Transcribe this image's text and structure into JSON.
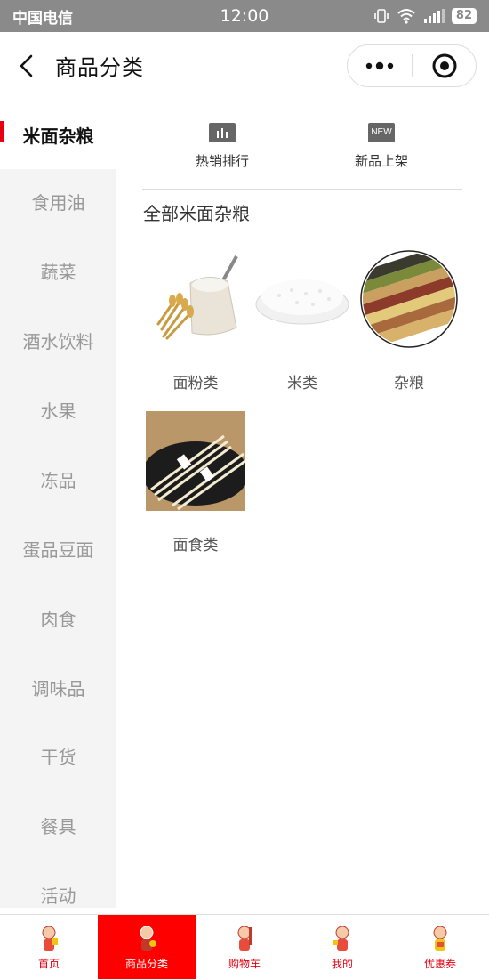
{
  "status_bar": {
    "carrier": "中国电信",
    "time": "12:00",
    "battery": "82"
  },
  "nav": {
    "title": "商品分类"
  },
  "sidebar": {
    "items": [
      {
        "label": "米面杂粮",
        "active": true
      },
      {
        "label": "食用油"
      },
      {
        "label": "蔬菜"
      },
      {
        "label": "酒水饮料"
      },
      {
        "label": "水果"
      },
      {
        "label": "冻品"
      },
      {
        "label": "蛋品豆面"
      },
      {
        "label": "肉食"
      },
      {
        "label": "调味品"
      },
      {
        "label": "干货"
      },
      {
        "label": "餐具"
      },
      {
        "label": "活动"
      }
    ]
  },
  "quick_links": [
    {
      "label": "热销排行",
      "icon": "bar-chart-icon"
    },
    {
      "label": "新品上架",
      "icon": "new-badge-icon",
      "badge_text": "NEW"
    }
  ],
  "section": {
    "title": "全部米面杂粮"
  },
  "products": [
    {
      "label": "面粉类",
      "image": "flour-sack"
    },
    {
      "label": "米类",
      "image": "rice-bowl"
    },
    {
      "label": "杂粮",
      "image": "grains-tray"
    },
    {
      "label": "面食类",
      "image": "noodles"
    }
  ],
  "tab_bar": {
    "items": [
      {
        "label": "首页"
      },
      {
        "label": "商品分类",
        "active": true
      },
      {
        "label": "购物车"
      },
      {
        "label": "我的"
      },
      {
        "label": "优惠券"
      }
    ]
  },
  "colors": {
    "accent": "#e60012",
    "active_tab": "#ff0000",
    "sidebar_bg": "#f4f4f4",
    "status_bg": "#8a8a8a"
  }
}
